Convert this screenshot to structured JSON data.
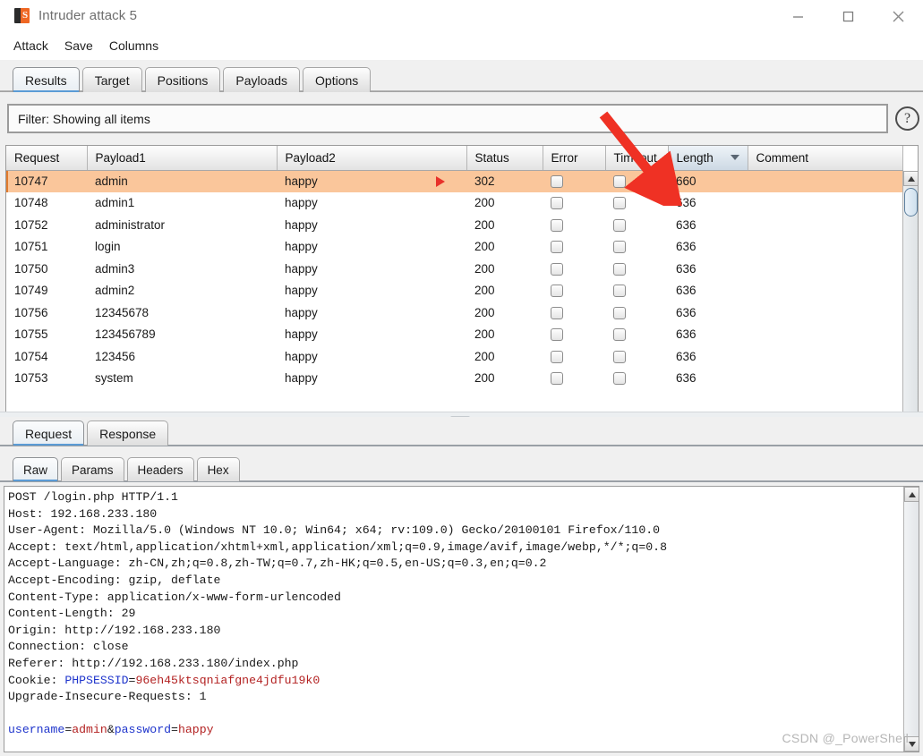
{
  "window": {
    "title": "Intruder attack 5",
    "icon": "burp-suite-icon",
    "minimize_label": "Minimize",
    "maximize_label": "Maximize",
    "close_label": "Close"
  },
  "menubar": {
    "items": [
      {
        "label": "Attack",
        "name": "menu-attack"
      },
      {
        "label": "Save",
        "name": "menu-save"
      },
      {
        "label": "Columns",
        "name": "menu-columns"
      }
    ]
  },
  "main_tabs": {
    "active": "Results",
    "items": [
      {
        "label": "Results"
      },
      {
        "label": "Target"
      },
      {
        "label": "Positions"
      },
      {
        "label": "Payloads"
      },
      {
        "label": "Options"
      }
    ]
  },
  "filter": {
    "text": "Filter: Showing all items",
    "help_label": "?"
  },
  "results_table": {
    "columns": [
      {
        "label": "Request",
        "sorted": false
      },
      {
        "label": "Payload1",
        "sorted": false
      },
      {
        "label": "Payload2",
        "sorted": false
      },
      {
        "label": "Status",
        "sorted": false
      },
      {
        "label": "Error",
        "sorted": false
      },
      {
        "label": "Timeout",
        "sorted": false
      },
      {
        "label": "Length",
        "sorted": true,
        "sort_dir": "desc"
      },
      {
        "label": "Comment",
        "sorted": false
      }
    ],
    "rows": [
      {
        "request": "10747",
        "payload1": "admin",
        "payload2": "happy",
        "status": "302",
        "error": false,
        "timeout": false,
        "length": "660",
        "comment": "",
        "highlighted": true,
        "marker": true
      },
      {
        "request": "10748",
        "payload1": "admin1",
        "payload2": "happy",
        "status": "200",
        "error": false,
        "timeout": false,
        "length": "636",
        "comment": "",
        "highlighted": false,
        "marker": false
      },
      {
        "request": "10752",
        "payload1": "administrator",
        "payload2": "happy",
        "status": "200",
        "error": false,
        "timeout": false,
        "length": "636",
        "comment": "",
        "highlighted": false,
        "marker": false
      },
      {
        "request": "10751",
        "payload1": "login",
        "payload2": "happy",
        "status": "200",
        "error": false,
        "timeout": false,
        "length": "636",
        "comment": "",
        "highlighted": false,
        "marker": false
      },
      {
        "request": "10750",
        "payload1": "admin3",
        "payload2": "happy",
        "status": "200",
        "error": false,
        "timeout": false,
        "length": "636",
        "comment": "",
        "highlighted": false,
        "marker": false
      },
      {
        "request": "10749",
        "payload1": "admin2",
        "payload2": "happy",
        "status": "200",
        "error": false,
        "timeout": false,
        "length": "636",
        "comment": "",
        "highlighted": false,
        "marker": false
      },
      {
        "request": "10756",
        "payload1": "12345678",
        "payload2": "happy",
        "status": "200",
        "error": false,
        "timeout": false,
        "length": "636",
        "comment": "",
        "highlighted": false,
        "marker": false
      },
      {
        "request": "10755",
        "payload1": "123456789",
        "payload2": "happy",
        "status": "200",
        "error": false,
        "timeout": false,
        "length": "636",
        "comment": "",
        "highlighted": false,
        "marker": false
      },
      {
        "request": "10754",
        "payload1": "123456",
        "payload2": "happy",
        "status": "200",
        "error": false,
        "timeout": false,
        "length": "636",
        "comment": "",
        "highlighted": false,
        "marker": false
      },
      {
        "request": "10753",
        "payload1": "system",
        "payload2": "happy",
        "status": "200",
        "error": false,
        "timeout": false,
        "length": "636",
        "comment": "",
        "highlighted": false,
        "marker": false
      }
    ]
  },
  "message_tabs": {
    "active": "Request",
    "items": [
      {
        "label": "Request"
      },
      {
        "label": "Response"
      }
    ]
  },
  "view_tabs": {
    "active": "Raw",
    "items": [
      {
        "label": "Raw"
      },
      {
        "label": "Params"
      },
      {
        "label": "Headers"
      },
      {
        "label": "Hex"
      }
    ]
  },
  "raw_request": {
    "lines": [
      {
        "text": "POST /login.php HTTP/1.1"
      },
      {
        "text": "Host: 192.168.233.180"
      },
      {
        "text": "User-Agent: Mozilla/5.0 (Windows NT 10.0; Win64; x64; rv:109.0) Gecko/20100101 Firefox/110.0"
      },
      {
        "text": "Accept: text/html,application/xhtml+xml,application/xml;q=0.9,image/avif,image/webp,*/*;q=0.8"
      },
      {
        "text": "Accept-Language: zh-CN,zh;q=0.8,zh-TW;q=0.7,zh-HK;q=0.5,en-US;q=0.3,en;q=0.2"
      },
      {
        "text": "Accept-Encoding: gzip, deflate"
      },
      {
        "text": "Content-Type: application/x-www-form-urlencoded"
      },
      {
        "text": "Content-Length: 29"
      },
      {
        "text": "Origin: http://192.168.233.180"
      },
      {
        "text": "Connection: close"
      },
      {
        "text": "Referer: http://192.168.233.180/index.php"
      },
      {
        "segments": [
          {
            "text": "Cookie: ",
            "color": "plain"
          },
          {
            "text": "PHPSESSID",
            "color": "blue"
          },
          {
            "text": "=",
            "color": "plain"
          },
          {
            "text": "96eh45ktsqniafgne4jdfu19k0",
            "color": "red"
          }
        ]
      },
      {
        "text": "Upgrade-Insecure-Requests: 1"
      },
      {
        "text": ""
      },
      {
        "segments": [
          {
            "text": "username",
            "color": "blue"
          },
          {
            "text": "=",
            "color": "plain"
          },
          {
            "text": "admin",
            "color": "red"
          },
          {
            "text": "&",
            "color": "plain"
          },
          {
            "text": "password",
            "color": "blue"
          },
          {
            "text": "=",
            "color": "plain"
          },
          {
            "text": "happy",
            "color": "red"
          }
        ]
      }
    ]
  },
  "annotation": {
    "arrow_color": "#ef3124",
    "points_to": "length-660"
  },
  "watermark": {
    "text": "CSDN @_PowerShell"
  },
  "colors": {
    "highlight_row": "#fac69b",
    "accent_tab": "#5b9bd5",
    "arrow_red": "#ef3124",
    "param_blue": "#1f35cc",
    "value_red": "#b32222"
  }
}
